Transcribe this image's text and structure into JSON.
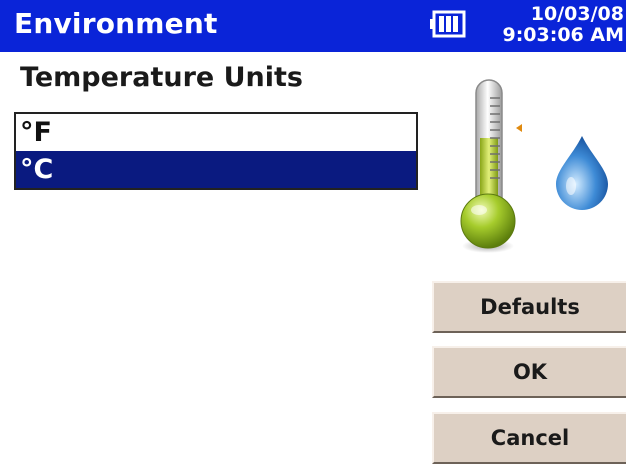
{
  "window": {
    "title": "Environment",
    "date": "10/03/08",
    "time": "9:03:06 AM"
  },
  "temperature_units": {
    "label": "Temperature Units",
    "options": [
      "°F",
      "°C"
    ],
    "selected": "°C"
  },
  "buttons": {
    "defaults": "Defaults",
    "ok": "OK",
    "cancel": "Cancel"
  },
  "icons": {
    "battery": "battery-icon",
    "thermometer": "thermometer-icon",
    "water_drop": "water-drop-icon"
  },
  "colors": {
    "titlebar": "#0a24d8",
    "selection": "#0a1a80",
    "button_face": "#ddd0c4"
  }
}
